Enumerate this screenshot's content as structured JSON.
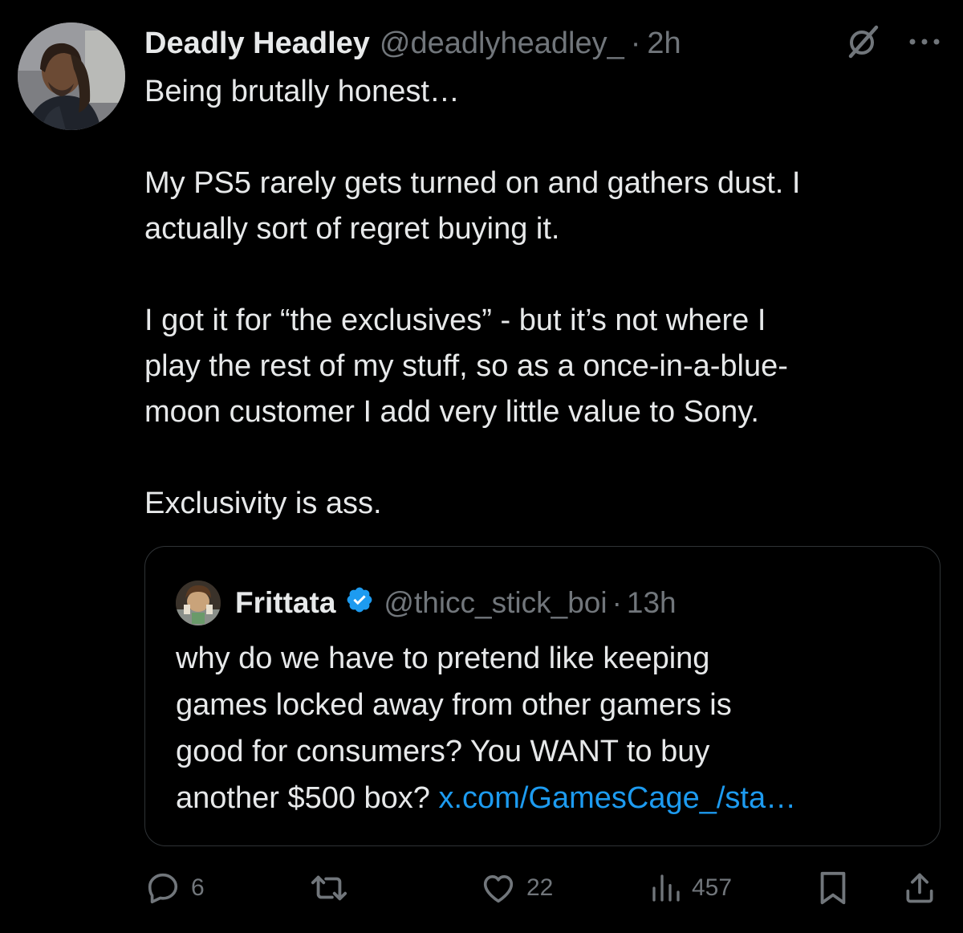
{
  "tweet": {
    "author_name": "Deadly Headley",
    "author_handle": "@deadlyheadley_",
    "separator": "·",
    "timestamp": "2h",
    "body": [
      "Being brutally honest…",
      "",
      "My PS5 rarely gets turned on and gathers dust. I",
      "actually sort of regret buying it.",
      "",
      "I got it for “the exclusives” - but it’s not where I",
      "play the rest of my stuff, so as a once-in-a-blue-",
      "moon customer I add very little value to Sony.",
      "",
      "Exclusivity is ass."
    ]
  },
  "quote": {
    "author_name": "Frittata",
    "verified": true,
    "author_handle": "@thicc_stick_boi",
    "separator": "·",
    "timestamp": "13h",
    "body": [
      "why do we have to pretend like keeping",
      "games locked away from other gamers is",
      "good for consumers? You WANT to buy"
    ],
    "last_line_text": "another $500 box? ",
    "link_text": "x.com/GamesCage_/sta…"
  },
  "actions": {
    "replies": "6",
    "likes": "22",
    "views": "457"
  },
  "icons": {
    "header": [
      "grok-icon",
      "more-icon"
    ],
    "action_bar": [
      "reply-icon",
      "retweet-icon",
      "like-icon",
      "views-icon",
      "bookmark-icon",
      "share-icon"
    ]
  },
  "colors": {
    "background": "#000000",
    "text": "#e7e9ea",
    "secondary": "#71767b",
    "link": "#1d9bf0",
    "verified": "#1d9bf0",
    "border": "#2f3336"
  }
}
